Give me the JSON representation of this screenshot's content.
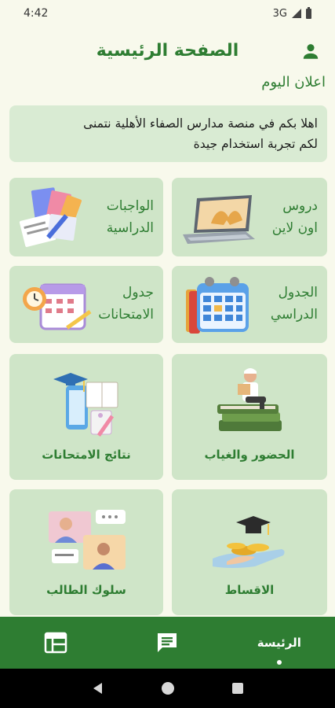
{
  "status": {
    "time": "4:42",
    "network": "3G"
  },
  "header": {
    "title": "الصفحة الرئيسية"
  },
  "announcement": {
    "section_label": "اعلان اليوم",
    "line1": "اهلا بكم في منصة مدارس الصفاء الأهلية نتمنى",
    "line2": "لكم تجربة استخدام جيدة"
  },
  "cards": {
    "online_lessons": {
      "line1": "دروس",
      "line2": "اون لاين",
      "icon": "laptop-book-icon"
    },
    "homework": {
      "line1": "الواجبات",
      "line2": "الدراسية",
      "icon": "books-stationery-icon"
    },
    "schedule": {
      "line1": "الجدول",
      "line2": "الدراسي",
      "icon": "calendar-icon"
    },
    "exam_schedule": {
      "line1": "جدول",
      "line2": "الامتحانات",
      "icon": "alarm-calendar-icon"
    },
    "attendance": {
      "label": "الحضور والغياب",
      "icon": "student-reading-icon"
    },
    "exam_results": {
      "label": "نتائج الامتحانات",
      "icon": "graduation-phone-icon"
    },
    "installments": {
      "label": "الاقساط",
      "icon": "hand-coins-icon"
    },
    "behavior": {
      "label": "سلوك الطالب",
      "icon": "video-chat-icon"
    }
  },
  "bottom_nav": {
    "home_label": "الرئيسة"
  },
  "colors": {
    "primary": "#2e7d32",
    "card": "#cfe5c8",
    "background": "#f8f9ec"
  }
}
